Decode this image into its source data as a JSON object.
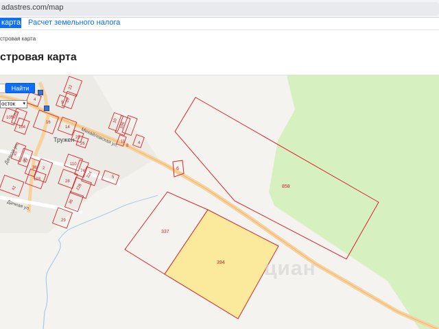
{
  "browser": {
    "url": "adastres.com/map"
  },
  "nav": {
    "active_tab": "карта",
    "link_tab": "Расчет земельного налога"
  },
  "breadcrumb": "стровая карта",
  "page_title": "стровая карта",
  "map": {
    "search_button": "Найти",
    "region_select": "осток",
    "place_name": "Тружен",
    "streets": {
      "mikhaylovskaya": "Михайловская ул.",
      "dachnaya_1": "Дачная ул.",
      "dachnaya_2": "Дачная ул."
    },
    "parcels": [
      {
        "id": "858",
        "highlighted": false
      },
      {
        "id": "337",
        "highlighted": false
      },
      {
        "id": "394",
        "highlighted": true
      },
      {
        "id": "6",
        "highlighted": false
      }
    ],
    "village_plots": [
      "22",
      "9",
      "20",
      "4",
      "5",
      "10",
      "106",
      "105",
      "104",
      "16",
      "14",
      "25",
      "26",
      "11",
      "8",
      "4",
      "45",
      "37",
      "35",
      "2",
      "38",
      "103",
      "110",
      "74",
      "224",
      "28",
      "36",
      "5",
      "228",
      "40",
      "32",
      "29"
    ],
    "watermark": "циан",
    "colors": {
      "map_bg": "#f4f3ef",
      "forest": "#d7f0c0",
      "parcel_border": "#d9252a",
      "highlight_fill": "#fbea9c",
      "road": "#f7d29d"
    }
  }
}
